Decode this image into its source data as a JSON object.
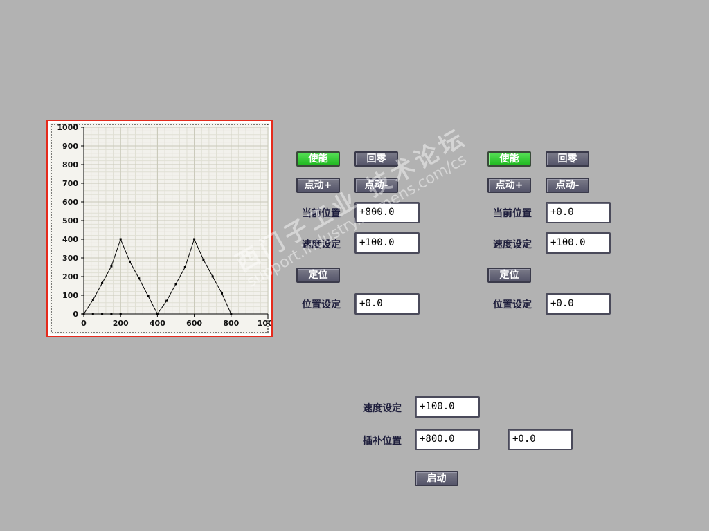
{
  "chart_data": {
    "type": "line",
    "x": [
      0,
      50,
      100,
      150,
      200,
      250,
      300,
      350,
      400,
      450,
      500,
      550,
      600,
      650,
      700,
      750,
      800
    ],
    "y": [
      0,
      75,
      165,
      255,
      400,
      280,
      190,
      95,
      0,
      70,
      160,
      250,
      400,
      290,
      200,
      110,
      0
    ],
    "baseline_x": [
      0,
      50,
      100,
      150,
      200
    ],
    "baseline_y": [
      0,
      0,
      0,
      0,
      0
    ],
    "xlim": [
      0,
      1000
    ],
    "ylim": [
      0,
      1000
    ],
    "x_ticks": [
      "0",
      "200",
      "400",
      "600",
      "800",
      "1000"
    ],
    "y_ticks": [
      "0",
      "100",
      "200",
      "300",
      "400",
      "500",
      "600",
      "700",
      "800",
      "900",
      "1000"
    ],
    "grid": true,
    "colors": {
      "frame": "#e52a1c",
      "plot_bg": "#f2f1ec",
      "grid_major": "#c8c8b8",
      "grid_minor": "#e0dfd4",
      "line": "#000000"
    }
  },
  "axis1": {
    "enable_label": "使能",
    "home_label": "回零",
    "jog_plus_label": "点动+",
    "jog_minus_label": "点动-",
    "current_pos_label": "当前位置",
    "current_pos_value": "+800.0",
    "speed_label": "速度设定",
    "speed_value": "+100.0",
    "position_button_label": "定位",
    "pos_setting_label": "位置设定",
    "pos_setting_value": "+0.0"
  },
  "axis2": {
    "enable_label": "使能",
    "home_label": "回零",
    "jog_plus_label": "点动+",
    "jog_minus_label": "点动-",
    "current_pos_label": "当前位置",
    "current_pos_value": "+0.0",
    "speed_label": "速度设定",
    "speed_value": "+100.0",
    "position_button_label": "定位",
    "pos_setting_label": "位置设定",
    "pos_setting_value": "+0.0"
  },
  "interp": {
    "speed_label": "速度设定",
    "speed_value": "+100.0",
    "pos_label": "插补位置",
    "pos_value_1": "+800.0",
    "pos_value_2": "+0.0",
    "start_label": "启动"
  },
  "watermark": {
    "text_cn": "西门子工业 技术论坛",
    "text_url": "support.industry.siemens.com/cs"
  },
  "colors": {
    "background": "#b2b2b2",
    "button": "#66667a",
    "button_active": "#2ec82e"
  }
}
